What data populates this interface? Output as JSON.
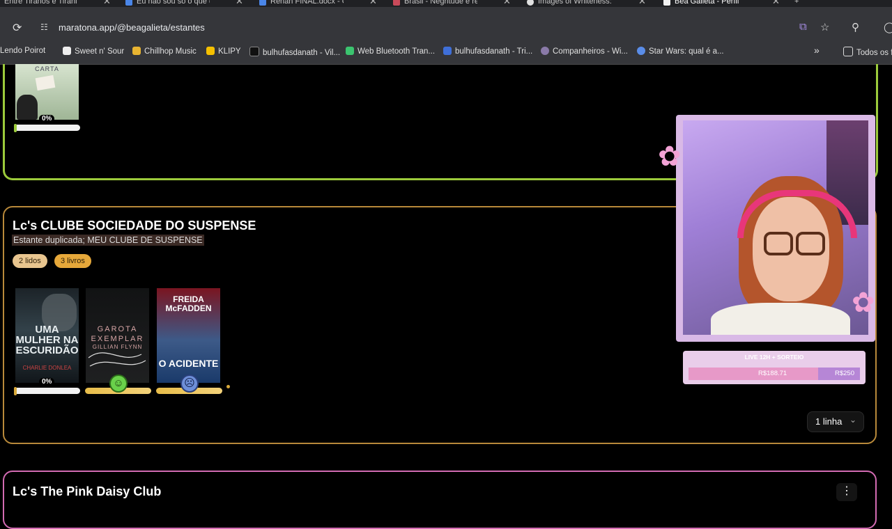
{
  "browser": {
    "tabs": [
      {
        "title": "Entre Tiranos e Tiranias.do"
      },
      {
        "title": "Eu não sou só o que dizem"
      },
      {
        "title": "Renan FINAL.docx - Googl"
      },
      {
        "title": "Brasil - Negritude e relaçõ"
      },
      {
        "title": "Images of Whiteness: The"
      },
      {
        "title": "Bea Galieta - Perfil"
      }
    ],
    "url": "maratona.app/@beagalieta/estantes",
    "bookmarks": [
      "Lendo Poirot",
      "Sweet n' Sour",
      "Chillhop Music",
      "KLIPY",
      "bulhufasdanath - Vil...",
      "Web Bluetooth Tran...",
      "bulhufasdanath - Tri...",
      "Companheiros - Wi...",
      "Star Wars: qual é a..."
    ],
    "all_favorites": "Todos os f",
    "more": "»"
  },
  "shelf1": {
    "book": {
      "cover_text": "CARTA",
      "progress": "0%"
    }
  },
  "shelf2": {
    "title": "Lc's CLUBE SOCIEDADE DO SUSPENSE",
    "subtitle": "Estante duplicada; MEU CLUBE DE SUSPENSE",
    "read_badge": "2 lidos",
    "books_badge": "3 livros",
    "books": [
      {
        "cover_text": "UMA MULHER NA ESCURIDÃO",
        "author": "CHARLIE DONLEA",
        "progress": "0%"
      },
      {
        "cover_text": "GAROTA EXEMPLAR",
        "author": "GILLIAN FLYNN",
        "status": "read-happy"
      },
      {
        "cover_text": "O ACIDENTE",
        "author": "FREIDA McFADDEN",
        "status": "read-sad"
      }
    ],
    "lines_button": "1 linha"
  },
  "shelf3": {
    "title": "Lc's The Pink Daisy Club"
  },
  "overlay": {
    "live_label": "LIVE 12H + SORTEIO",
    "current": "R$188.71",
    "goal": "R$250",
    "progress": 0.755
  }
}
